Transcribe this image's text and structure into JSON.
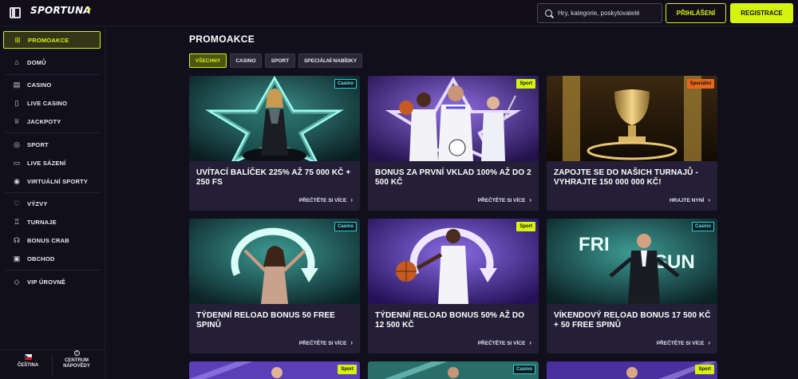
{
  "header": {
    "logo": "SPORTUNA",
    "search_placeholder": "Hry, kategorie, poskytovatelé",
    "login_label": "PŘIHLÁŠENÍ",
    "register_label": "REGISTRACE"
  },
  "sidebar": {
    "items": [
      {
        "label": "PROMOAKCE",
        "icon": "gift-icon"
      },
      {
        "label": "DOMŮ",
        "icon": "home-icon"
      },
      {
        "label": "CASINO",
        "icon": "cards-icon"
      },
      {
        "label": "LIVE CASINO",
        "icon": "phone-icon"
      },
      {
        "label": "JACKPOTY",
        "icon": "jackpot-icon"
      },
      {
        "label": "SPORT",
        "icon": "ball-icon"
      },
      {
        "label": "LIVE SÁZENÍ",
        "icon": "video-icon"
      },
      {
        "label": "VIRTUÁLNÍ SPORTY",
        "icon": "controller-icon"
      },
      {
        "label": "VÝZVY",
        "icon": "trophy-icon"
      },
      {
        "label": "TURNAJE",
        "icon": "tournament-icon"
      },
      {
        "label": "BONUS CRAB",
        "icon": "crab-icon"
      },
      {
        "label": "OBCHOD",
        "icon": "store-icon"
      },
      {
        "label": "VIP ÚROVNĚ",
        "icon": "diamond-icon"
      }
    ],
    "language": "ČEŠTINA",
    "help_line1": "CENTRUM",
    "help_line2": "NÁPOVĚDY"
  },
  "main": {
    "title": "PROMOAKCE",
    "tabs": [
      {
        "label": "VŠECHNY",
        "active": true
      },
      {
        "label": "CASINO",
        "active": false
      },
      {
        "label": "SPORT",
        "active": false
      },
      {
        "label": "SPECIÁLNÍ NABÍDKY",
        "active": false
      }
    ],
    "cards": [
      {
        "badge": "Casino",
        "title": "UVÍTACÍ BALÍČEK 225% AŽ 75 000 KČ + 250 FS",
        "cta": "PŘEČTĚTE SI VÍCE"
      },
      {
        "badge": "Sport",
        "title": "BONUS ZA PRVNÍ VKLAD 100% AŽ DO 2 500 KČ",
        "cta": "PŘEČTĚTE SI VÍCE"
      },
      {
        "badge": "Speciální",
        "title": "ZAPOJTE SE DO NAŠICH TURNAJŮ - VYHRAJTE 150 000 000 KČ!",
        "cta": "HRAJTE NYNÍ"
      },
      {
        "badge": "Casino",
        "title": "TÝDENNÍ RELOAD BONUS 50 FREE SPINŮ",
        "cta": "PŘEČTĚTE SI VÍCE"
      },
      {
        "badge": "Sport",
        "title": "TÝDENNÍ RELOAD BONUS 50% AŽ DO 12 500 KČ",
        "cta": "PŘEČTĚTE SI VÍCE"
      },
      {
        "badge": "Casino",
        "title": "VÍKENDOVÝ RELOAD BONUS 17 500 KČ + 50 FREE SPINŮ",
        "cta": "PŘEČTĚTE SI VÍCE",
        "image_text_1": "FRI",
        "image_text_2": "SUN"
      },
      {
        "badge": "Sport"
      },
      {
        "badge": "Casino"
      },
      {
        "badge": "Sport"
      }
    ]
  },
  "colors": {
    "accent": "#d4f30e",
    "background": "#120f1c",
    "card": "#241f36"
  }
}
